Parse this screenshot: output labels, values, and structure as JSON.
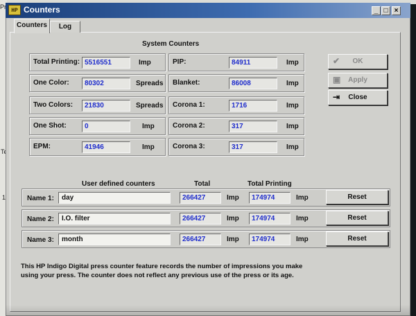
{
  "background": {
    "top_left_text": "Pri",
    "left_marker_1": "Te",
    "left_marker_2": "1"
  },
  "window": {
    "app_icon": "HP",
    "title": "Counters",
    "controls": {
      "minimize": "_",
      "maximize": "□",
      "close": "×"
    }
  },
  "tabs": [
    {
      "label": "Counters",
      "active": true
    },
    {
      "label": "Log",
      "active": false
    }
  ],
  "system_counters": {
    "title": "System Counters",
    "left": [
      {
        "label": "Total Printing:",
        "value": "5516551",
        "unit": "Imp"
      },
      {
        "label": "One Color:",
        "value": "80302",
        "unit": "Spreads"
      },
      {
        "label": "Two Colors:",
        "value": "21830",
        "unit": "Spreads"
      },
      {
        "label": "One Shot:",
        "value": "0",
        "unit": "Imp"
      },
      {
        "label": "EPM:",
        "value": "41946",
        "unit": "Imp"
      }
    ],
    "right": [
      {
        "label": "PIP:",
        "value": "84911",
        "unit": "Imp"
      },
      {
        "label": "Blanket:",
        "value": "86008",
        "unit": "Imp"
      },
      {
        "label": "Corona 1:",
        "value": "1716",
        "unit": "Imp"
      },
      {
        "label": "Corona 2:",
        "value": "317",
        "unit": "Imp"
      },
      {
        "label": "Corona 3:",
        "value": "317",
        "unit": "Imp"
      }
    ]
  },
  "side_buttons": {
    "ok": {
      "label": "OK",
      "icon": "checkmark-icon",
      "enabled": false
    },
    "apply": {
      "label": "Apply",
      "icon": "save-disk-icon",
      "enabled": false
    },
    "close": {
      "label": "Close",
      "icon": "exit-door-icon",
      "enabled": true
    }
  },
  "user_counters": {
    "header_title": "User defined counters",
    "header_total": "Total",
    "header_total_printing": "Total Printing",
    "rows": [
      {
        "label": "Name 1:",
        "name": "day",
        "total": "266427",
        "total_unit": "Imp",
        "total_printing": "174974",
        "printing_unit": "Imp",
        "reset_label": "Reset"
      },
      {
        "label": "Name 2:",
        "name": "I.O. filter",
        "total": "266427",
        "total_unit": "Imp",
        "total_printing": "174974",
        "printing_unit": "Imp",
        "reset_label": "Reset"
      },
      {
        "label": "Name 3:",
        "name": "month",
        "total": "266427",
        "total_unit": "Imp",
        "total_printing": "174974",
        "printing_unit": "Imp",
        "reset_label": "Reset"
      }
    ]
  },
  "footnote": {
    "line1": "This HP Indigo Digital press counter feature records the number of impressions you make",
    "line2": "using your press. The counter does not reflect any previous use of the press or its age."
  },
  "colors": {
    "value_text": "#1e2ccc",
    "titlebar": "#1b3f7a"
  }
}
